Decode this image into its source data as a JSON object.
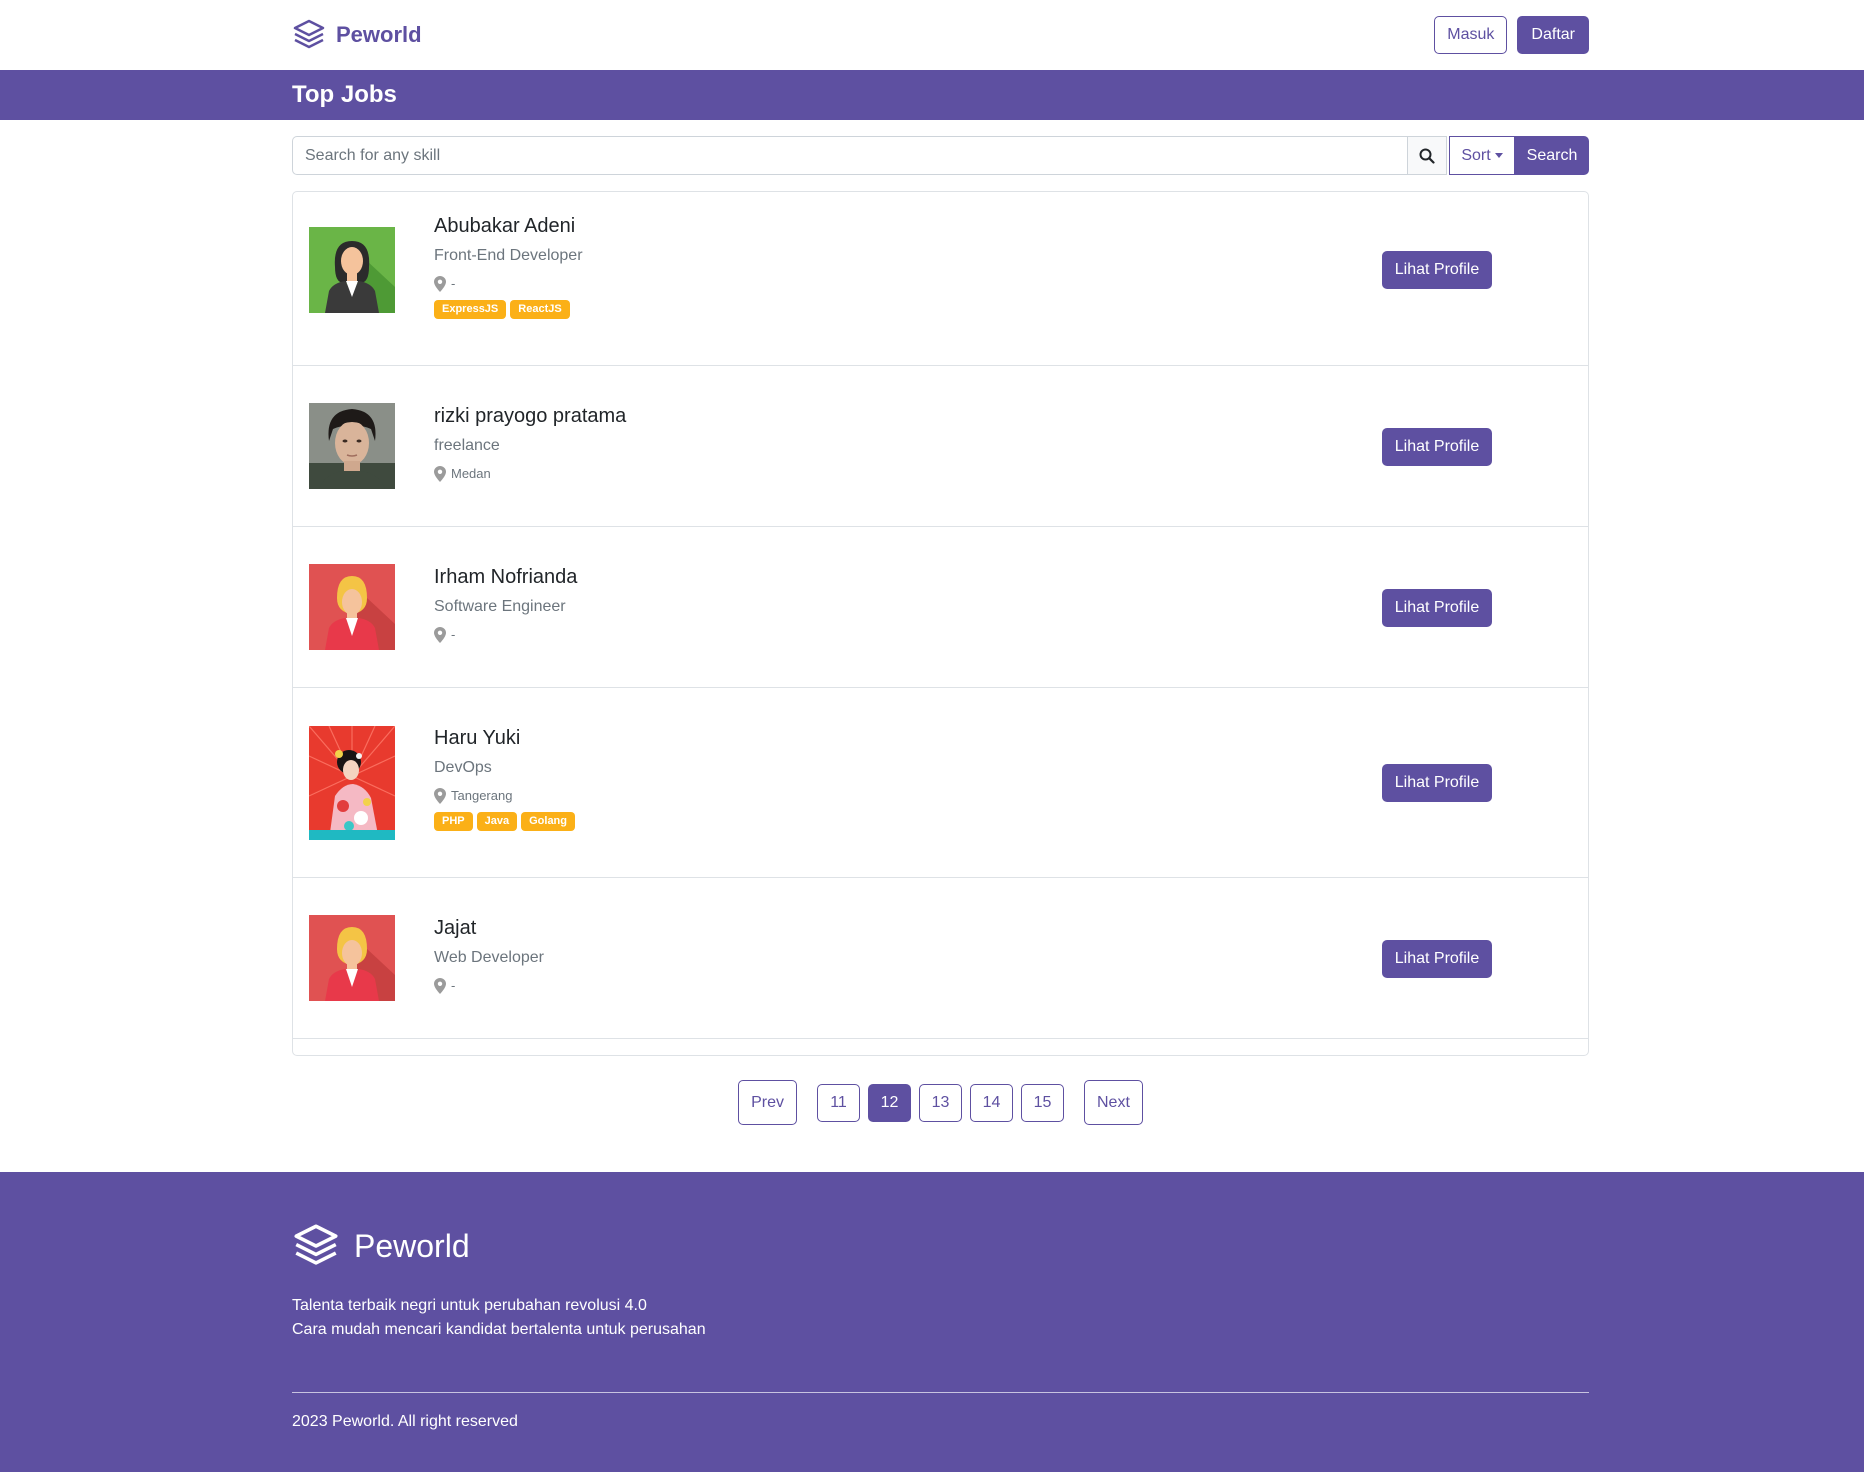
{
  "nav": {
    "brand": "Peworld",
    "login_label": "Masuk",
    "register_label": "Daftar"
  },
  "banner": {
    "title": "Top Jobs"
  },
  "search": {
    "placeholder": "Search for any skill",
    "sort_label": "Sort",
    "search_label": "Search"
  },
  "candidates": [
    {
      "name": "Abubakar Adeni",
      "job": "Front-End Developer",
      "location": "-",
      "skills": [
        "ExpressJS",
        "ReactJS"
      ],
      "button": "Lihat Profile",
      "avatar": "female-green"
    },
    {
      "name": "rizki prayogo pratama",
      "job": "freelance",
      "location": "Medan",
      "skills": [],
      "button": "Lihat Profile",
      "avatar": "male-photo"
    },
    {
      "name": "Irham Nofrianda",
      "job": "Software Engineer",
      "location": "-",
      "skills": [],
      "button": "Lihat Profile",
      "avatar": "female-red"
    },
    {
      "name": "Haru Yuki",
      "job": "DevOps",
      "location": "Tangerang",
      "skills": [
        "PHP",
        "Java",
        "Golang"
      ],
      "button": "Lihat Profile",
      "avatar": "kimono-photo"
    },
    {
      "name": "Jajat",
      "job": "Web Developer",
      "location": "-",
      "skills": [],
      "button": "Lihat Profile",
      "avatar": "female-red"
    }
  ],
  "pagination": {
    "prev": "Prev",
    "pages": [
      "11",
      "12",
      "13",
      "14",
      "15"
    ],
    "active": "12",
    "next": "Next"
  },
  "footer": {
    "brand": "Peworld",
    "tagline_1": "Talenta terbaik negri untuk perubahan revolusi 4.0",
    "tagline_2": "Cara mudah mencari kandidat bertalenta untuk perusahan",
    "copyright": "2023 Peworld. All right reserved"
  },
  "colors": {
    "primary": "#5e50a1",
    "skill": "#fbb017"
  }
}
